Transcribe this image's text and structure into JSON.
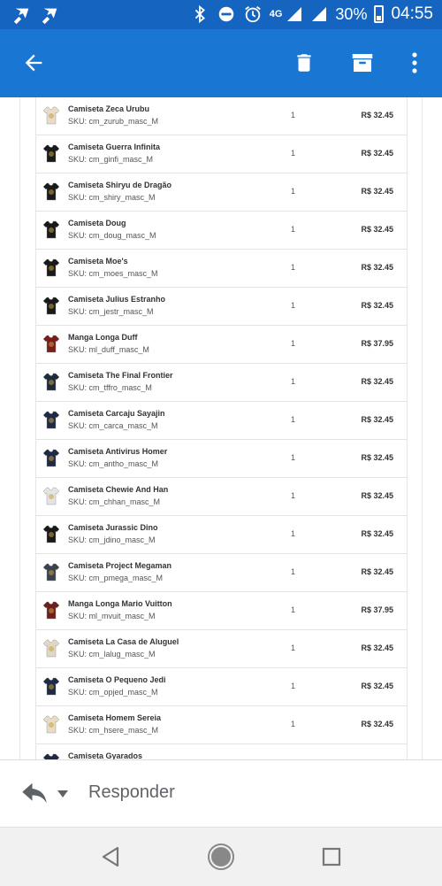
{
  "status_bar": {
    "network": "4G",
    "battery": "30%",
    "time": "04:55",
    "icons": [
      "app-icon-1",
      "app-icon-2",
      "bluetooth-icon",
      "do-not-disturb-icon",
      "alarm-icon",
      "signal-icon",
      "signal-icon",
      "battery-icon"
    ]
  },
  "app_bar": {
    "color": "#1976d2",
    "status_color": "#1565c0",
    "icons": [
      "back-arrow-icon",
      "delete-icon",
      "archive-icon",
      "more-vert-icon"
    ]
  },
  "order": {
    "items": [
      {
        "name": "Camiseta Zeca Urubu",
        "sku": "SKU: cm_zurub_masc_M",
        "qty": "1",
        "price": "R$ 32.45",
        "shirt_color": "#e8dcc8"
      },
      {
        "name": "Camiseta Guerra Infinita",
        "sku": "SKU: cm_ginfi_masc_M",
        "qty": "1",
        "price": "R$ 32.45",
        "shirt_color": "#1a1a1a"
      },
      {
        "name": "Camiseta Shiryu de Dragão",
        "sku": "SKU: cm_shiry_masc_M",
        "qty": "1",
        "price": "R$ 32.45",
        "shirt_color": "#1a1a1a"
      },
      {
        "name": "Camiseta Doug",
        "sku": "SKU: cm_doug_masc_M",
        "qty": "1",
        "price": "R$ 32.45",
        "shirt_color": "#1a1a1a"
      },
      {
        "name": "Camiseta Moe's",
        "sku": "SKU: cm_moes_masc_M",
        "qty": "1",
        "price": "R$ 32.45",
        "shirt_color": "#1a1a1a"
      },
      {
        "name": "Camiseta Julius Estranho",
        "sku": "SKU: cm_jestr_masc_M",
        "qty": "1",
        "price": "R$ 32.45",
        "shirt_color": "#1a1a1a"
      },
      {
        "name": "Manga Longa Duff",
        "sku": "SKU: ml_duff_masc_M",
        "qty": "1",
        "price": "R$ 37.95",
        "shirt_color": "#7a1d1d"
      },
      {
        "name": "Camiseta The Final Frontier",
        "sku": "SKU: cm_tffro_masc_M",
        "qty": "1",
        "price": "R$ 32.45",
        "shirt_color": "#1f2a3a"
      },
      {
        "name": "Camiseta Carcaju Sayajin",
        "sku": "SKU: cm_carca_masc_M",
        "qty": "1",
        "price": "R$ 32.45",
        "shirt_color": "#1f2a44"
      },
      {
        "name": "Camiseta Antivirus Homer",
        "sku": "SKU: cm_antho_masc_M",
        "qty": "1",
        "price": "R$ 32.45",
        "shirt_color": "#1f2a44"
      },
      {
        "name": "Camiseta Chewie And Han",
        "sku": "SKU: cm_chhan_masc_M",
        "qty": "1",
        "price": "R$ 32.45",
        "shirt_color": "#e4e4e4"
      },
      {
        "name": "Camiseta Jurassic Dino",
        "sku": "SKU: cm_jdino_masc_M",
        "qty": "1",
        "price": "R$ 32.45",
        "shirt_color": "#1a1a1a"
      },
      {
        "name": "Camiseta Project Megaman",
        "sku": "SKU: cm_pmega_masc_M",
        "qty": "1",
        "price": "R$ 32.45",
        "shirt_color": "#3a4250"
      },
      {
        "name": "Manga Longa Mario Vuitton",
        "sku": "SKU: ml_mvuit_masc_M",
        "qty": "1",
        "price": "R$ 37.95",
        "shirt_color": "#6e1f1f"
      },
      {
        "name": "Camiseta La Casa de Aluguel",
        "sku": "SKU: cm_lalug_masc_M",
        "qty": "1",
        "price": "R$ 32.45",
        "shirt_color": "#e0d6c4"
      },
      {
        "name": "Camiseta O Pequeno Jedi",
        "sku": "SKU: cm_opjed_masc_M",
        "qty": "1",
        "price": "R$ 32.45",
        "shirt_color": "#1f2a44"
      },
      {
        "name": "Camiseta Homem Sereia",
        "sku": "SKU: cm_hsere_masc_M",
        "qty": "1",
        "price": "R$ 32.45",
        "shirt_color": "#e8dcc4"
      },
      {
        "name": "Camiseta Gyarados",
        "sku": "",
        "qty": "",
        "price": "",
        "shirt_color": "#1f2a44"
      }
    ]
  },
  "reply_bar": {
    "label": "Responder",
    "icons": [
      "reply-icon",
      "dropdown-icon"
    ]
  },
  "nav_bar": {
    "icons": [
      "back-triangle-icon",
      "home-circle-icon",
      "recents-square-icon"
    ]
  }
}
